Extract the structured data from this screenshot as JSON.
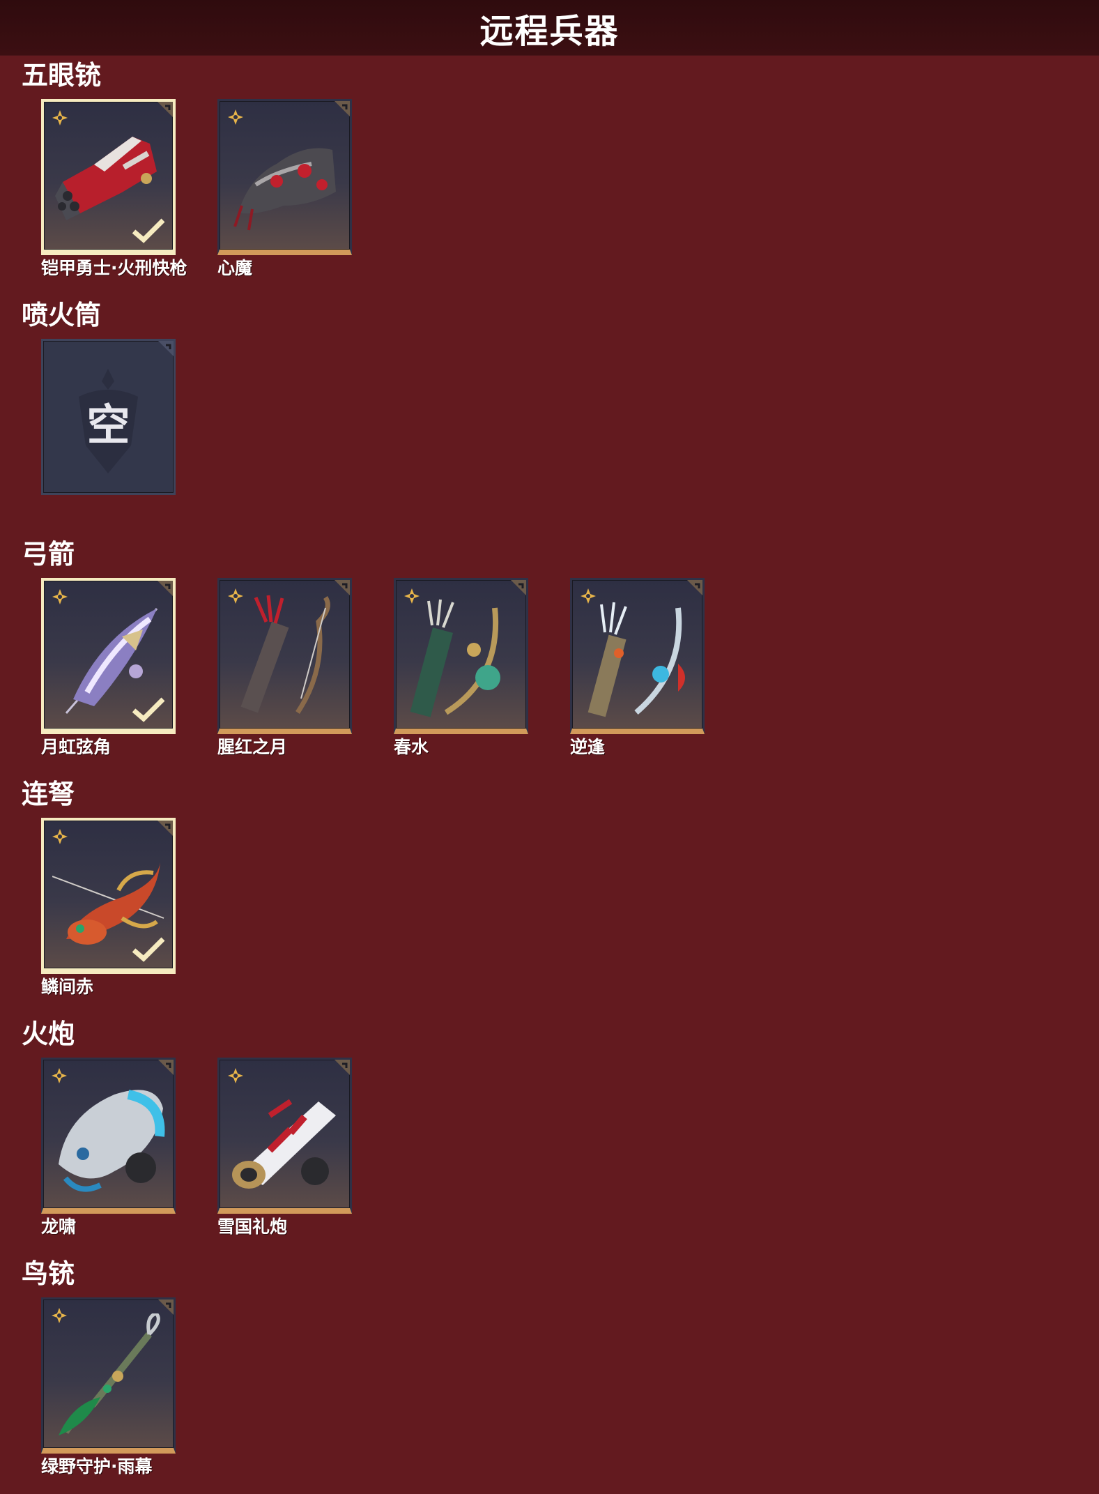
{
  "header": {
    "title": "远程兵器"
  },
  "sections": [
    {
      "title": "五眼铳",
      "items": [
        {
          "name": "铠甲勇士·火刑快枪",
          "selected": true,
          "empty": false,
          "art": "red-gun-art"
        },
        {
          "name": "心魔",
          "selected": false,
          "empty": false,
          "art": "demon-gun-art"
        }
      ]
    },
    {
      "title": "喷火筒",
      "items": [
        {
          "name": "",
          "glyph": "空",
          "selected": false,
          "empty": true,
          "art": "empty-slot"
        }
      ]
    },
    {
      "title": "弓箭",
      "items": [
        {
          "name": "月虹弦角",
          "selected": true,
          "empty": false,
          "art": "moon-bow-art"
        },
        {
          "name": "腥红之月",
          "selected": false,
          "empty": false,
          "art": "crimson-bow-art"
        },
        {
          "name": "春水",
          "selected": false,
          "empty": false,
          "art": "jade-bow-art"
        },
        {
          "name": "逆逢",
          "selected": false,
          "empty": false,
          "art": "ice-bow-art"
        }
      ]
    },
    {
      "title": "连弩",
      "items": [
        {
          "name": "鳞间赤",
          "selected": true,
          "empty": false,
          "art": "koi-crossbow-art"
        }
      ]
    },
    {
      "title": "火炮",
      "items": [
        {
          "name": "龙啸",
          "selected": false,
          "empty": false,
          "art": "dragon-cannon-art"
        },
        {
          "name": "雪国礼炮",
          "selected": false,
          "empty": false,
          "art": "snow-cannon-art"
        }
      ]
    },
    {
      "title": "鸟铳",
      "items": [
        {
          "name": "绿野守护·雨幕",
          "selected": false,
          "empty": false,
          "art": "green-musket-art"
        }
      ]
    }
  ],
  "colors": {
    "background": "#631a1f",
    "header": "#2f0b0e",
    "selected_border": "#f6ebc0",
    "rarity_bar": "#d29a5a",
    "star": "#e8b54a"
  }
}
